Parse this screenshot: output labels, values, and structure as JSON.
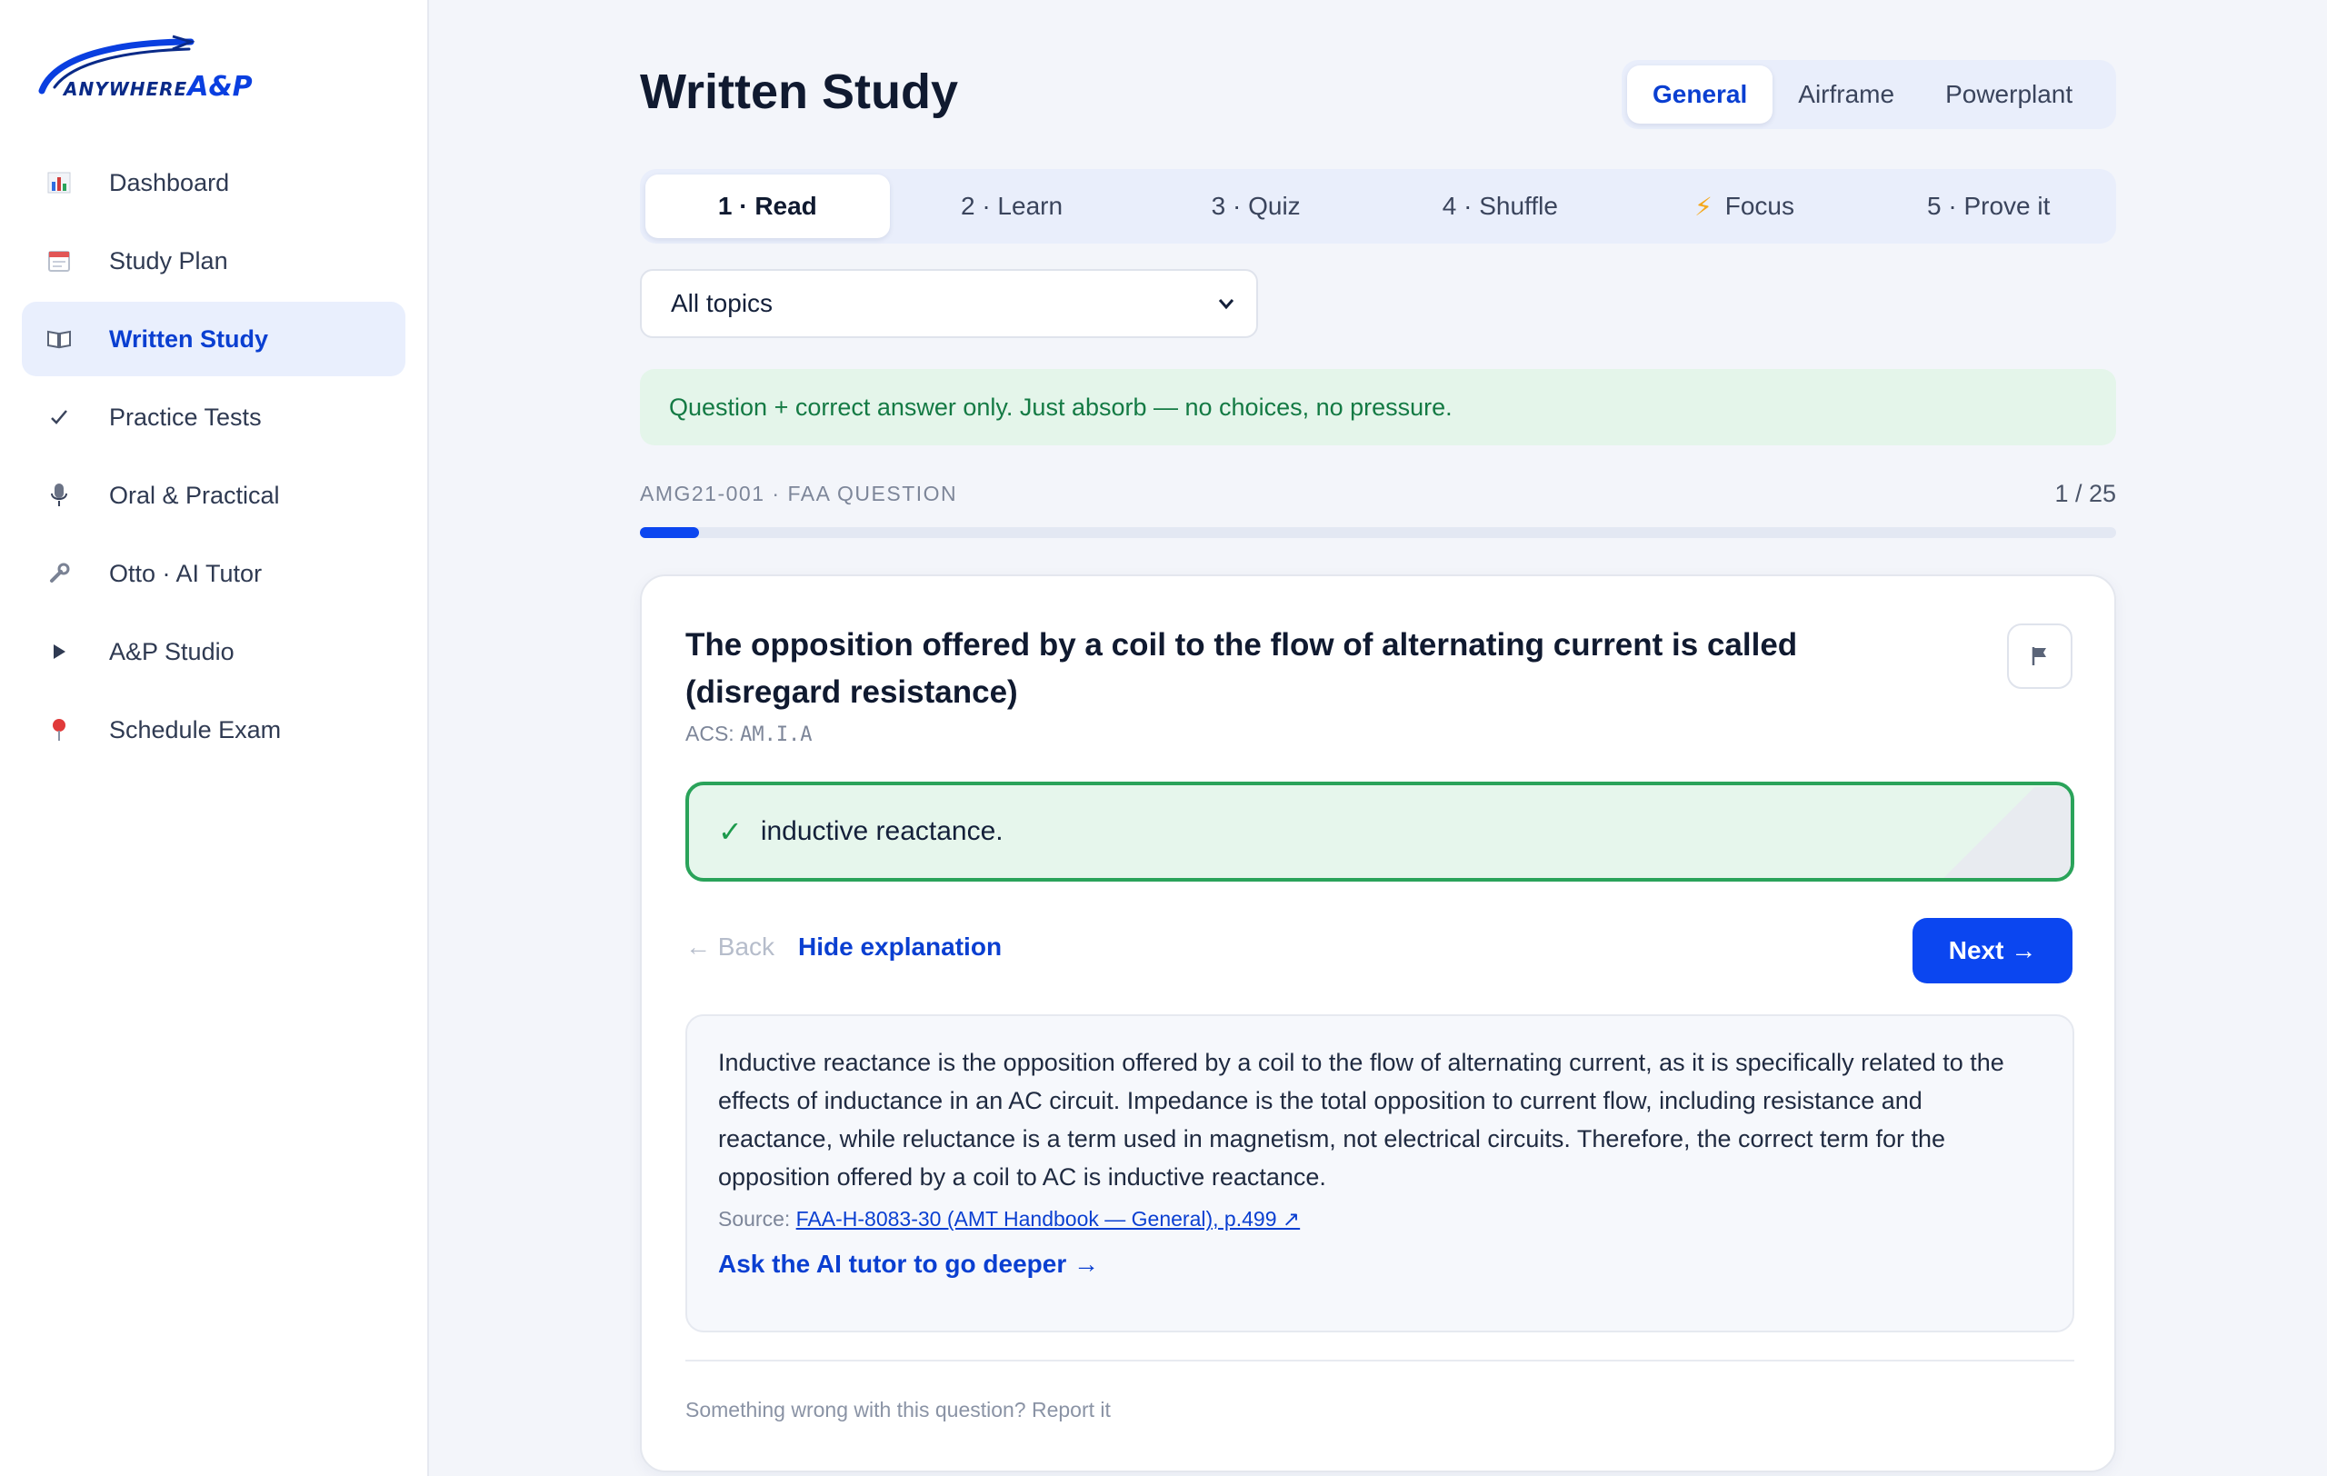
{
  "brand": {
    "word1": "ANYWHERE",
    "word2": "A&P"
  },
  "sidebar": {
    "items": [
      {
        "label": "Dashboard",
        "icon": "bar-chart-icon"
      },
      {
        "label": "Study Plan",
        "icon": "calendar-icon"
      },
      {
        "label": "Written Study",
        "icon": "book-icon",
        "active": true
      },
      {
        "label": "Practice Tests",
        "icon": "check-icon"
      },
      {
        "label": "Oral & Practical",
        "icon": "microphone-icon"
      },
      {
        "label": "Otto · AI Tutor",
        "icon": "wrench-icon"
      },
      {
        "label": "A&P Studio",
        "icon": "play-icon"
      },
      {
        "label": "Schedule Exam",
        "icon": "pin-icon"
      }
    ]
  },
  "header": {
    "title": "Written Study",
    "cert_tabs": [
      "General",
      "Airframe",
      "Powerplant"
    ],
    "active_cert": "General"
  },
  "mode_tabs": {
    "items": [
      "1 · Read",
      "2 · Learn",
      "3 · Quiz",
      "4 · Shuffle",
      "Focus",
      "5 · Prove it"
    ],
    "active": "1 · Read"
  },
  "topic_filter": {
    "selected": "All topics"
  },
  "hint": "Question + correct answer only. Just absorb — no choices, no pressure.",
  "question_meta": {
    "id": "AMG21-001 · FAA QUESTION",
    "position": "1 / 25",
    "progress": 0.04
  },
  "question": {
    "text": "The opposition offered by a coil to the flow of alternating current is called (disregard resistance)",
    "acs_label": "ACS:",
    "acs_code": "AM.I.A",
    "answer": "inductive reactance."
  },
  "actions": {
    "back": "← Back",
    "hide": "Hide explanation",
    "next": "Next →"
  },
  "explanation": {
    "text": "Inductive reactance is the opposition offered by a coil to the flow of alternating current, as it is specifically related to the effects of inductance in an AC circuit. Impedance is the total opposition to current flow, including resistance and reactance, while reluctance is a term used in magnetism, not electrical circuits. Therefore, the correct term for the opposition offered by a coil to AC is inductive reactance.",
    "source_label": "Source:",
    "source_link": "FAA-H-8083-30 (AMT Handbook — General), p.499 ↗",
    "ask_ai": "Ask the AI tutor to go deeper →"
  },
  "report": "Something wrong with this question? Report it",
  "colors": {
    "accent": "#0b46f0",
    "success": "#2aa35a",
    "sidebar_active_bg": "#e9effd"
  }
}
